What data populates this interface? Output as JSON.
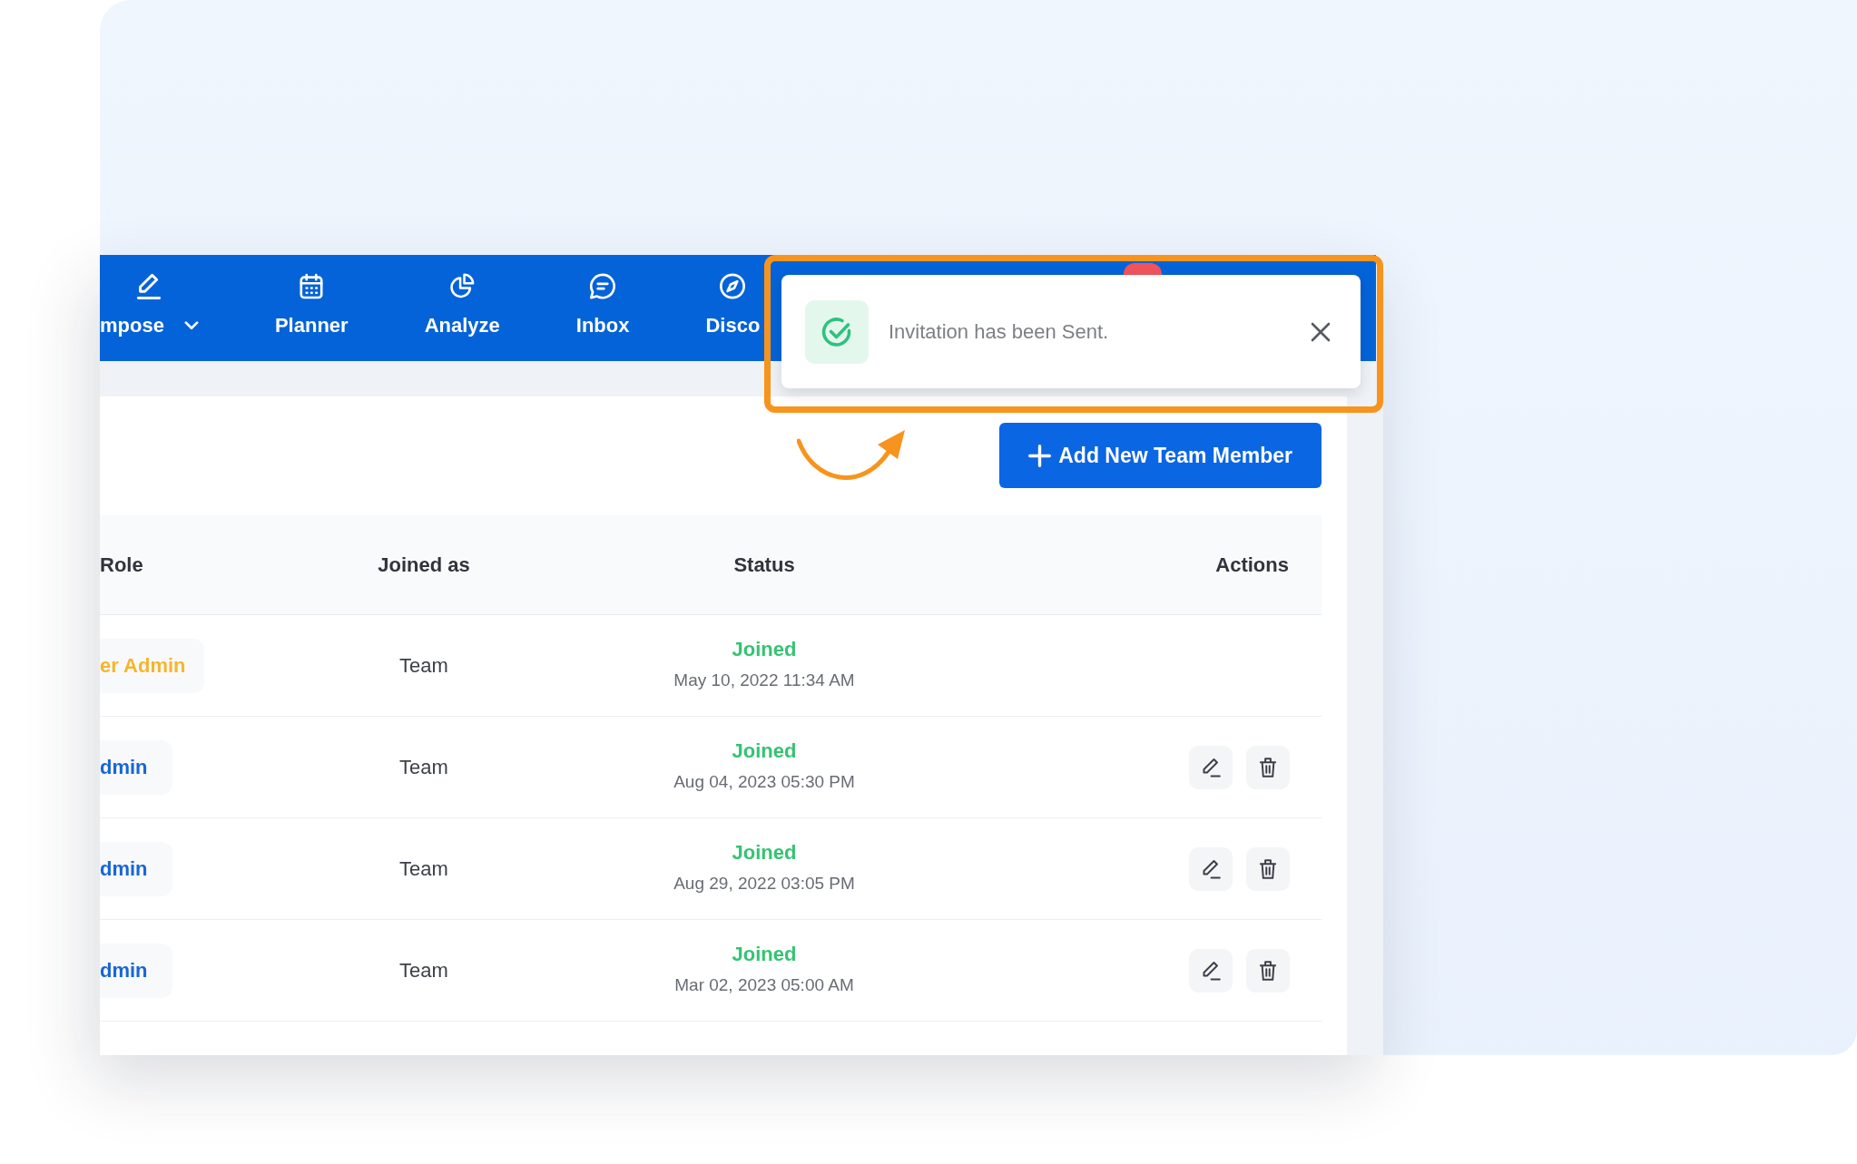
{
  "nav": {
    "items": [
      {
        "label": "mpose",
        "kind": "compose",
        "dropdown": true,
        "selected": false
      },
      {
        "label": "Planner",
        "kind": "planner",
        "dropdown": false,
        "selected": false
      },
      {
        "label": "Analyze",
        "kind": "analyze",
        "dropdown": false,
        "selected": false
      },
      {
        "label": "Inbox",
        "kind": "inbox",
        "dropdown": false,
        "selected": false
      },
      {
        "label": "Disco",
        "kind": "discover",
        "dropdown": false,
        "selected": false
      }
    ],
    "notification_badge": true
  },
  "toast": {
    "message": "Invitation has been Sent."
  },
  "annotations": {
    "highlight_frame": true,
    "curved_arrow": true
  },
  "add_button": {
    "label": "Add New Team Member"
  },
  "table": {
    "columns": [
      "Role",
      "Joined as",
      "Status",
      "Actions"
    ],
    "rows": [
      {
        "role": {
          "label": "er Admin",
          "color": "#f7b52c"
        },
        "joined_as": "Team",
        "status": "Joined",
        "date": "May 10, 2022 11:34 AM",
        "actions": false
      },
      {
        "role": {
          "label": "dmin",
          "color": "#1766d8"
        },
        "joined_as": "Team",
        "status": "Joined",
        "date": "Aug 04, 2023 05:30 PM",
        "actions": true
      },
      {
        "role": {
          "label": "dmin",
          "color": "#1766d8"
        },
        "joined_as": "Team",
        "status": "Joined",
        "date": "Aug 29, 2022 03:05 PM",
        "actions": true
      },
      {
        "role": {
          "label": "dmin",
          "color": "#1766d8"
        },
        "joined_as": "Team",
        "status": "Joined",
        "date": "Mar 02, 2023 05:00 AM",
        "actions": true
      }
    ]
  }
}
